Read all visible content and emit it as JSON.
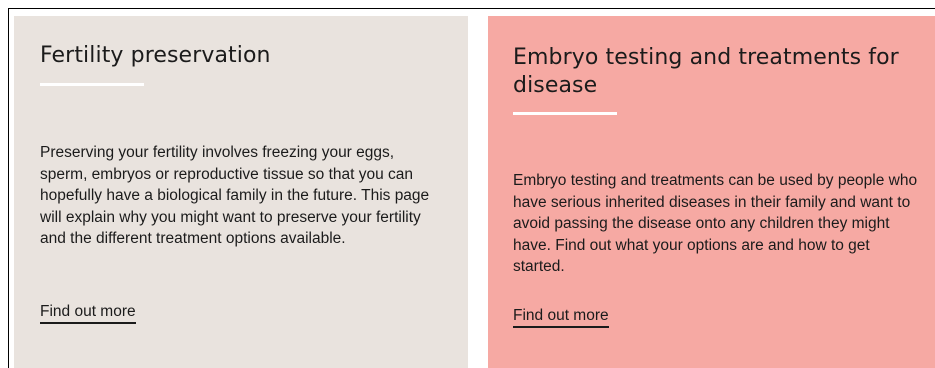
{
  "cards": [
    {
      "title": "Fertility preservation",
      "body": "Preserving your fertility involves freezing your eggs, sperm, embryos or reproductive tissue so that you can hopefully have a biological family in the future. This page will explain why you might want to preserve your fertility and the different treatment options available.",
      "link_label": "Find out more",
      "background": "#e9e3de"
    },
    {
      "title": "Embryo testing and treatments for disease",
      "body": "Embryo testing and treatments can be used by people who have serious inherited diseases in their family and want to avoid passing the disease onto any children they might have. Find out what your options are and how to get started.",
      "link_label": "Find out more",
      "background": "#f6a9a3"
    }
  ],
  "colors": {
    "text": "#1b1b1b",
    "rule": "#ffffff"
  }
}
